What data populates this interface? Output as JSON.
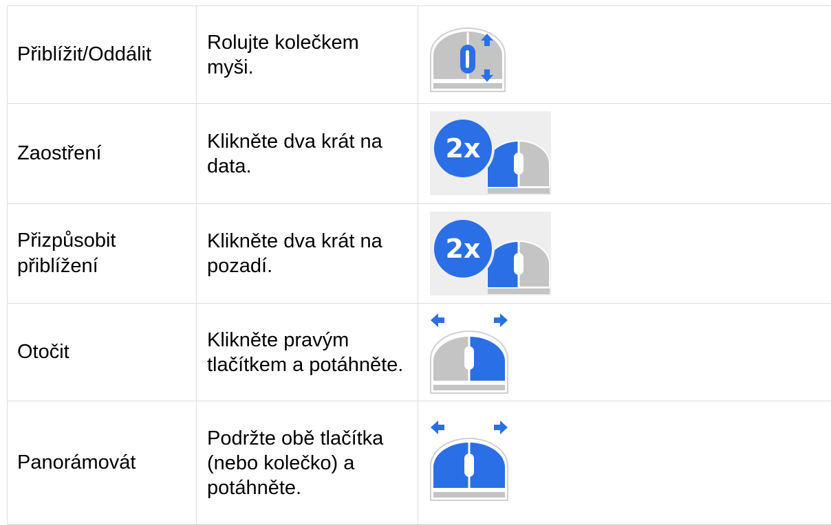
{
  "rows": [
    {
      "action": "Přiblížit/Oddálit",
      "description": "Rolujte kolečkem myši.",
      "icon": "mouse-scroll-wheel-icon"
    },
    {
      "action": "Zaostření",
      "description": "Klikněte dva krát na data.",
      "icon": "double-click-left-icon"
    },
    {
      "action": "Přizpůsobit přiblížení",
      "description": "Klikněte dva krát na pozadí.",
      "icon": "double-click-left-icon"
    },
    {
      "action": "Otočit",
      "description": "Klikněte pravým tlačítkem a potáhněte.",
      "icon": "right-drag-icon"
    },
    {
      "action": "Panorámovát",
      "description": "Podržte obě tlačítka (nebo kolečko) a potáhněte.",
      "icon": "both-buttons-drag-icon"
    }
  ],
  "badge": {
    "label": "2x"
  },
  "colors": {
    "accent_blue": "#2b6fe6",
    "mouse_gray": "#c4c4c4",
    "icon_bg": "#eeeeee",
    "border": "#dcdcdc"
  }
}
